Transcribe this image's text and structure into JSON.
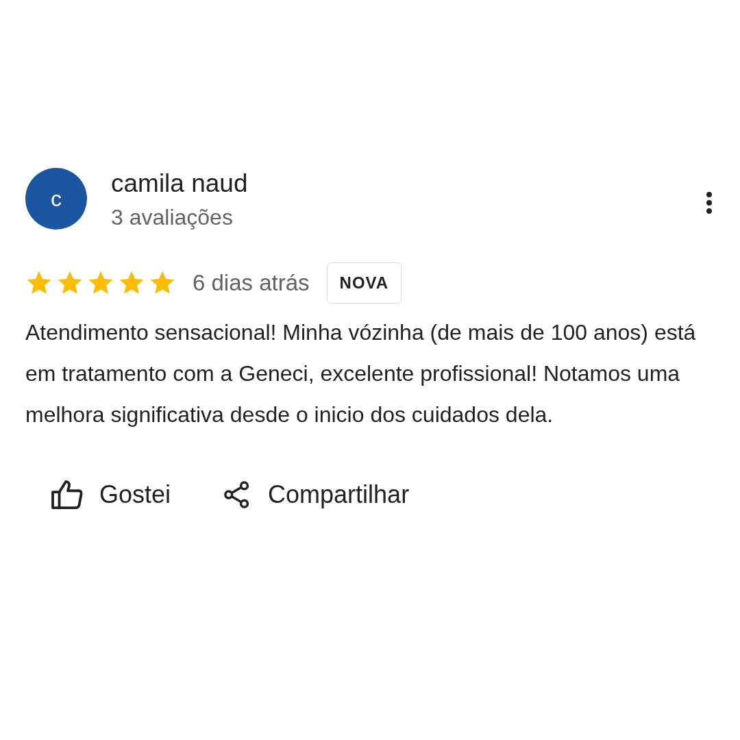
{
  "review": {
    "avatar_letter": "c",
    "author": "camila naud",
    "review_count": "3 avaliações",
    "stars": 5,
    "time": "6 dias atrás",
    "badge": "NOVA",
    "text": "Atendimento sensacional! Minha vózinha (de mais de 100 anos) está em tratamento com a Geneci, excelente profissional! Notamos uma melhora significativa desde o inicio dos cuidados dela."
  },
  "actions": [
    {
      "kind": "like",
      "label": "Gostei"
    },
    {
      "kind": "share",
      "label": "Compartilhar"
    }
  ]
}
